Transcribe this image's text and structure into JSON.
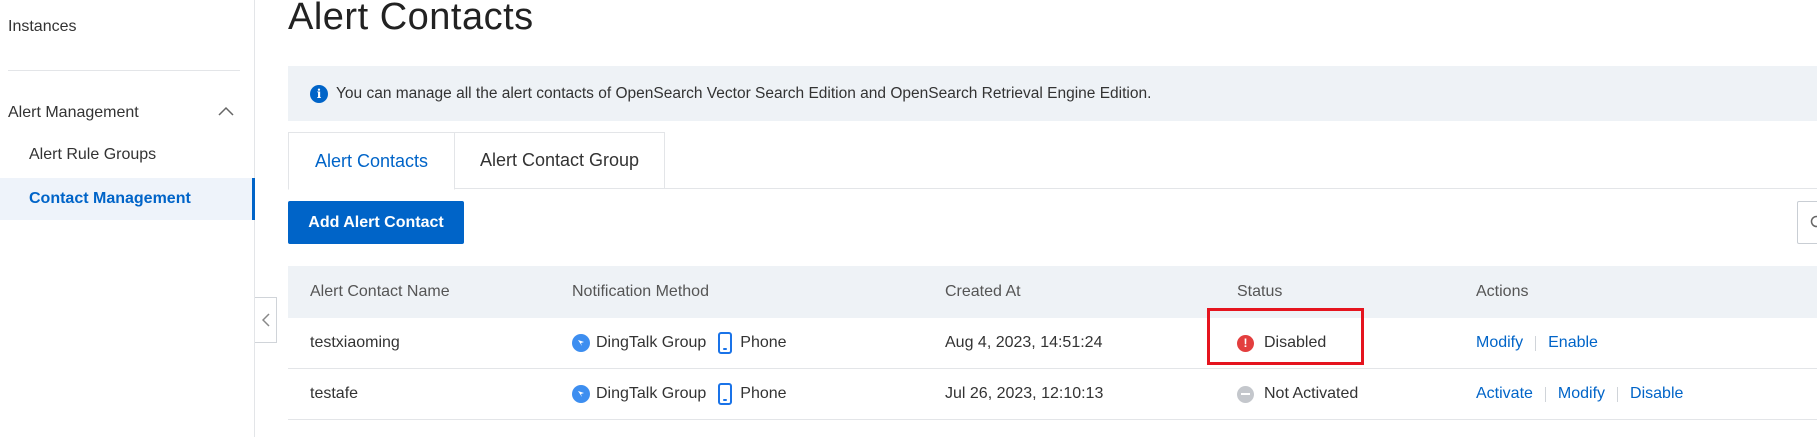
{
  "sidebar": {
    "instances": "Instances",
    "group_label": "Alert Management",
    "sub_items": [
      "Alert Rule Groups",
      "Contact Management"
    ]
  },
  "page": {
    "title": "Alert Contacts",
    "notice": "You can manage all the alert contacts of OpenSearch Vector Search Edition and OpenSearch Retrieval Engine Edition.",
    "tabs": [
      "Alert Contacts",
      "Alert Contact Group"
    ],
    "add_button": "Add Alert Contact"
  },
  "table": {
    "headers": [
      "Alert Contact Name",
      "Notification Method",
      "Created At",
      "Status",
      "Actions"
    ],
    "rows": [
      {
        "name": "testxiaoming",
        "methods": [
          "DingTalk Group",
          "Phone"
        ],
        "created": "Aug 4, 2023, 14:51:24",
        "status": "Disabled",
        "actions": [
          "Modify",
          "Enable"
        ]
      },
      {
        "name": "testafe",
        "methods": [
          "DingTalk Group",
          "Phone"
        ],
        "created": "Jul 26, 2023, 12:10:13",
        "status": "Not Activated",
        "actions": [
          "Activate",
          "Modify",
          "Disable"
        ]
      }
    ]
  },
  "colors": {
    "primary": "#0064c8",
    "highlight": "#e5141e",
    "error": "#e33e3e"
  }
}
